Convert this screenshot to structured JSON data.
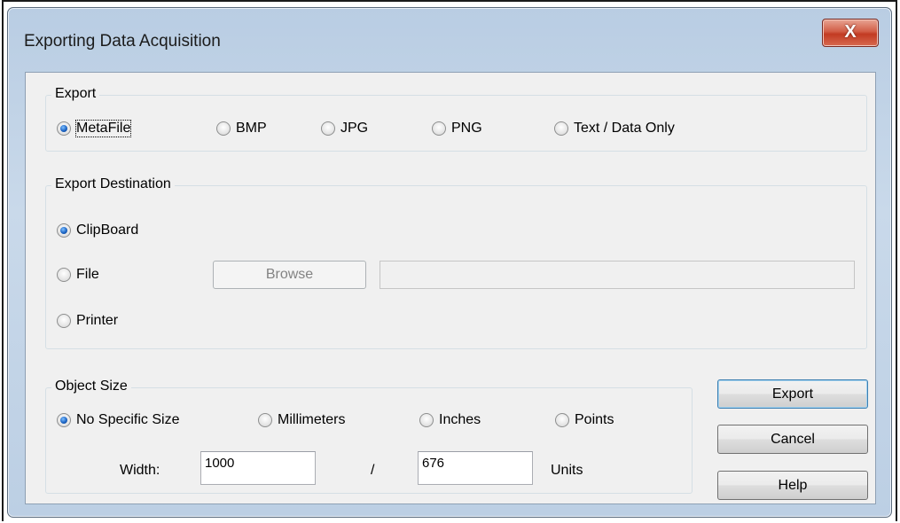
{
  "window": {
    "title": "Exporting Data Acquisition",
    "close_label": "X"
  },
  "export": {
    "group_label": "Export",
    "options": [
      {
        "label": "MetaFile",
        "checked": true
      },
      {
        "label": "BMP",
        "checked": false
      },
      {
        "label": "JPG",
        "checked": false
      },
      {
        "label": "PNG",
        "checked": false
      },
      {
        "label": "Text / Data Only",
        "checked": false
      }
    ]
  },
  "destination": {
    "group_label": "Export Destination",
    "options": [
      {
        "label": "ClipBoard",
        "checked": true
      },
      {
        "label": "File",
        "checked": false
      },
      {
        "label": "Printer",
        "checked": false
      }
    ],
    "browse_label": "Browse",
    "file_path": ""
  },
  "object_size": {
    "group_label": "Object Size",
    "options": [
      {
        "label": "No Specific Size",
        "checked": true
      },
      {
        "label": "Millimeters",
        "checked": false
      },
      {
        "label": "Inches",
        "checked": false
      },
      {
        "label": "Points",
        "checked": false
      }
    ],
    "width_label": "Width:",
    "width_value": "1000",
    "separator": "/",
    "height_value": "676",
    "units_label": "Units"
  },
  "buttons": {
    "export": "Export",
    "cancel": "Cancel",
    "help": "Help"
  },
  "colors": {
    "title_bar": "#bccfe4",
    "client_background": "#f0f0f0",
    "close_button": "#c23a22",
    "radio_selected": "#1c64c4"
  }
}
